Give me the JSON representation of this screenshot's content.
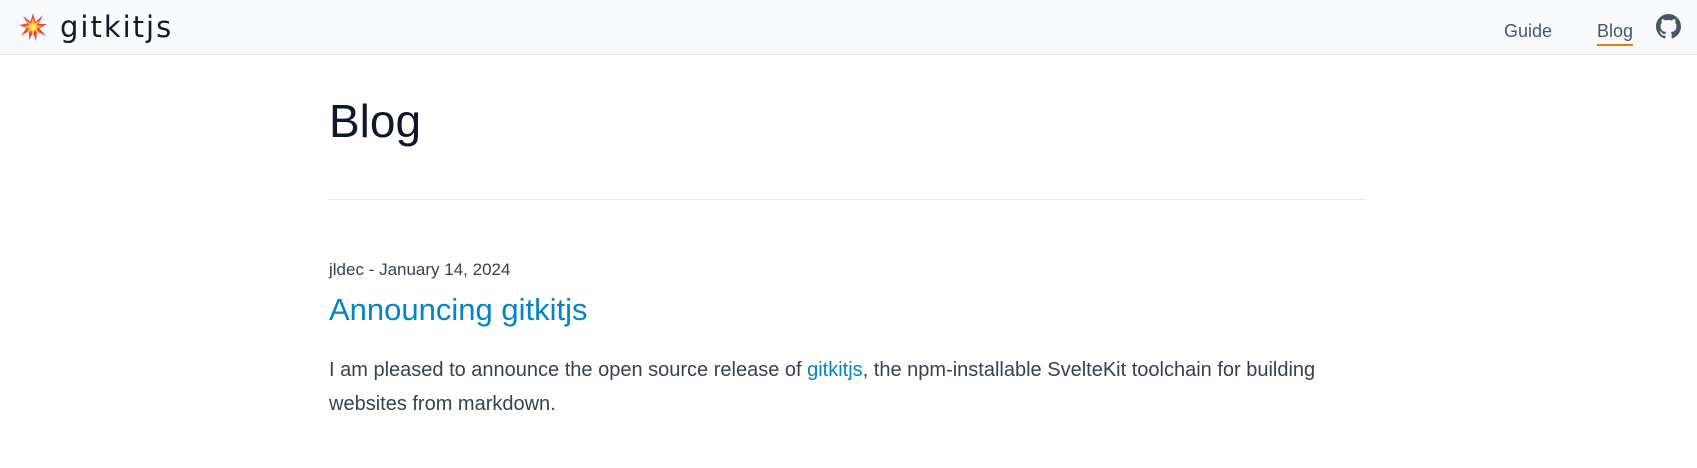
{
  "header": {
    "brand": "gitkitjs",
    "logo_icon": "explosion-spark-icon",
    "nav": [
      {
        "label": "Guide"
      },
      {
        "label": "Blog",
        "active": true
      }
    ],
    "github_icon": "github-icon"
  },
  "main": {
    "title": "Blog",
    "posts": [
      {
        "meta": "jldec - January 14, 2024",
        "title": "Announcing gitkitjs",
        "excerpt_before": "I am pleased to announce the open source release of ",
        "excerpt_link": "gitkitjs",
        "excerpt_after": ", the npm-installable SvelteKit toolchain for building websites from markdown."
      }
    ]
  },
  "colors": {
    "accent": "#0284c7",
    "active_underline": "#f97316",
    "header_bg": "#f8fafc"
  }
}
